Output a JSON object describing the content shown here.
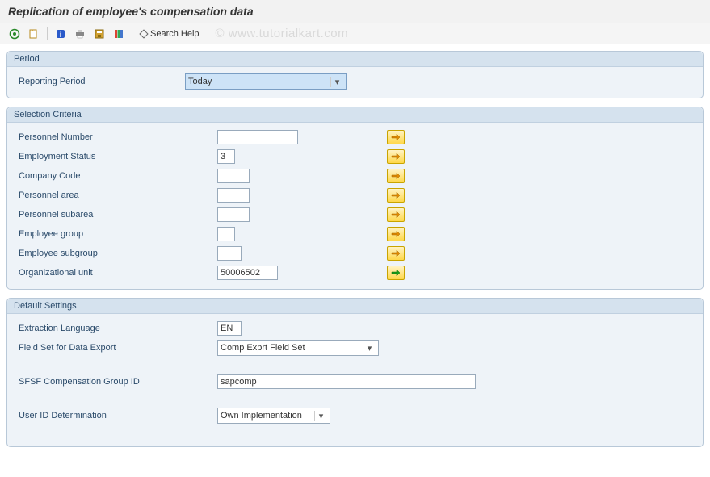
{
  "title": "Replication of employee's compensation data",
  "toolbar": {
    "search_help_label": "Search Help",
    "watermark": "© www.tutorialkart.com"
  },
  "groups": {
    "period": {
      "title": "Period",
      "reporting_period_label": "Reporting Period",
      "reporting_period_value": "Today"
    },
    "selection": {
      "title": "Selection Criteria",
      "personnel_number_label": "Personnel Number",
      "personnel_number_value": "",
      "employment_status_label": "Employment Status",
      "employment_status_value": "3",
      "company_code_label": "Company Code",
      "company_code_value": "",
      "personnel_area_label": "Personnel area",
      "personnel_area_value": "",
      "personnel_subarea_label": "Personnel subarea",
      "personnel_subarea_value": "",
      "employee_group_label": "Employee group",
      "employee_group_value": "",
      "employee_subgroup_label": "Employee subgroup",
      "employee_subgroup_value": "",
      "org_unit_label": "Organizational unit",
      "org_unit_value": "50006502"
    },
    "defaults": {
      "title": "Default Settings",
      "extraction_lang_label": "Extraction Language",
      "extraction_lang_value": "EN",
      "field_set_label": "Field Set for Data Export",
      "field_set_value": "Comp Exprt Field Set",
      "sfsf_group_label": "SFSF Compensation Group ID",
      "sfsf_group_value": "sapcomp",
      "user_id_label": "User ID Determination",
      "user_id_value": "Own Implementation"
    }
  }
}
